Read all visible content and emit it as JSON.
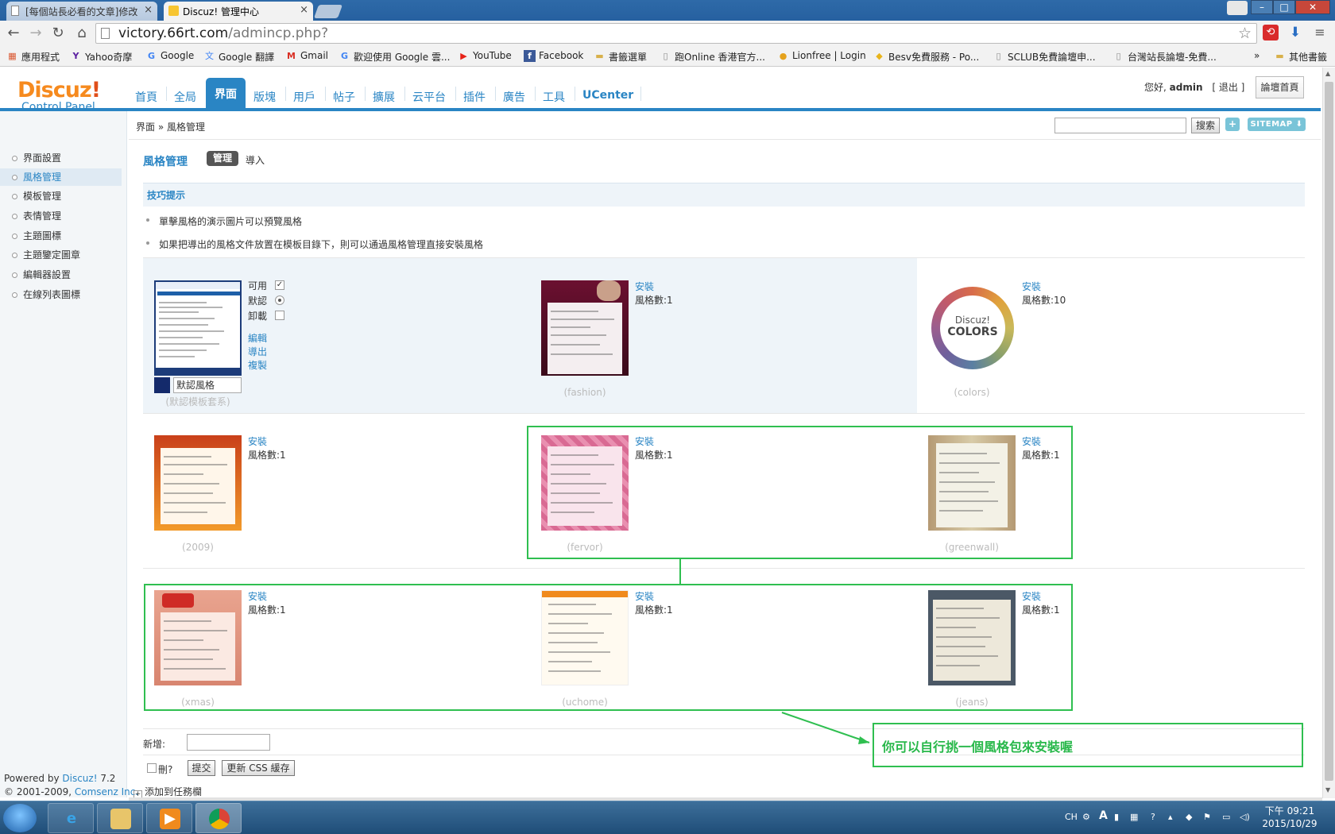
{
  "browser": {
    "tabs": [
      {
        "label": "[每個站長必看的文章]修改",
        "close": "×"
      },
      {
        "label": "Discuz! 管理中心",
        "close": "×"
      }
    ],
    "window_controls": {
      "minimize": "–",
      "maximize": "□",
      "close": "✕"
    },
    "url_host": "victory.66rt.com",
    "url_path": "/admincp.php?",
    "bookmarks": [
      {
        "label": "應用程式",
        "icon": "apps-grid-icon"
      },
      {
        "label": "Yahoo奇摩",
        "icon": "yahoo-icon"
      },
      {
        "label": "Google",
        "icon": "google-icon"
      },
      {
        "label": "Google 翻譯",
        "icon": "translate-icon"
      },
      {
        "label": "Gmail",
        "icon": "gmail-icon"
      },
      {
        "label": "歡迎使用 Google 雲...",
        "icon": "google-icon"
      },
      {
        "label": "YouTube",
        "icon": "youtube-icon"
      },
      {
        "label": "Facebook",
        "icon": "facebook-icon"
      },
      {
        "label": "書籤選單",
        "icon": "folder-icon"
      },
      {
        "label": "跑Online 香港官方...",
        "icon": "page-icon"
      },
      {
        "label": "Lionfree | Login",
        "icon": "lionfree-icon"
      },
      {
        "label": "Besv免費服務 - Po...",
        "icon": "besv-icon"
      },
      {
        "label": "SCLUB免費論壇申...",
        "icon": "page-icon"
      },
      {
        "label": "台灣站長論壇-免費...",
        "icon": "page-icon"
      }
    ],
    "bookmarks_overflow": "»",
    "other_bookmarks": "其他書籤"
  },
  "header": {
    "logo_main": "Discuz",
    "logo_mark": "!",
    "logo_sub": "Control Panel",
    "nav": [
      "首頁",
      "全局",
      "界面",
      "版塊",
      "用戶",
      "帖子",
      "擴展",
      "云平台",
      "插件",
      "廣告",
      "工具",
      "UCenter"
    ],
    "active_nav": "界面",
    "greeting": "您好, ",
    "username": "admin",
    "logout": "[ 退出 ]",
    "forum_home": "論壇首頁"
  },
  "breadcrumb": "界面 » 風格管理",
  "search": {
    "button": "搜索",
    "plus": "+",
    "sitemap": "SITEMAP ⬇"
  },
  "sidebar": {
    "items": [
      "界面設置",
      "風格管理",
      "模板管理",
      "表情管理",
      "主題圖標",
      "主題鑒定圖章",
      "編輯器設置",
      "在線列表圖標"
    ],
    "active_index": 1,
    "powered_prefix": "Powered by ",
    "powered_brand": "Discuz!",
    "powered_version": " 7.2",
    "copyright_prefix": "© 2001-2009, ",
    "copyright_company": "Comsenz Inc."
  },
  "main": {
    "title": "風格管理",
    "tab_manage": "管理",
    "tab_import": "導入",
    "tips_title": "技巧提示",
    "tips": [
      "單擊風格的演示圖片可以預覽風格",
      "如果把導出的風格文件放置在模板目錄下，則可以通過風格管理直接安裝風格"
    ],
    "default_style": {
      "enabled_label": "可用",
      "default_label": "默認",
      "uninstall_label": "卸載",
      "enabled": true,
      "is_default": true,
      "uninstall": false,
      "actions": [
        "編輯",
        "導出",
        "複製"
      ],
      "name": "默認風格",
      "caption": "(默認模板套系)",
      "swatch_color": "#142a6b"
    },
    "install_label": "安裝",
    "count_label": "風格數:",
    "styles": [
      {
        "caption": "(fashion)",
        "count": 1
      },
      {
        "caption": "(colors)",
        "count": 10
      },
      {
        "caption": "(2009)",
        "count": 1
      },
      {
        "caption": "(fervor)",
        "count": 1
      },
      {
        "caption": "(greenwall)",
        "count": 1
      },
      {
        "caption": "(xmas)",
        "count": 1
      },
      {
        "caption": "(uchome)",
        "count": 1
      },
      {
        "caption": "(jeans)",
        "count": 1
      }
    ],
    "colors_logo_l1": "Discuz!",
    "colors_logo_l2": "COLORS",
    "add_label": "新增:",
    "delete_label": "刪?",
    "submit": "提交",
    "update_css": "更新 CSS 緩存",
    "add_task": "添加到任務欄",
    "add_task_icon": "+"
  },
  "annotation": {
    "text": "你可以自行挑一個風格包來安裝喔",
    "color": "#2fbf50"
  },
  "taskbar": {
    "lang": "CH",
    "time": "下午 09:21",
    "date": "2015/10/29"
  },
  "colors": {
    "accent": "#2a85c4",
    "logo_orange": "#f68a1e"
  }
}
